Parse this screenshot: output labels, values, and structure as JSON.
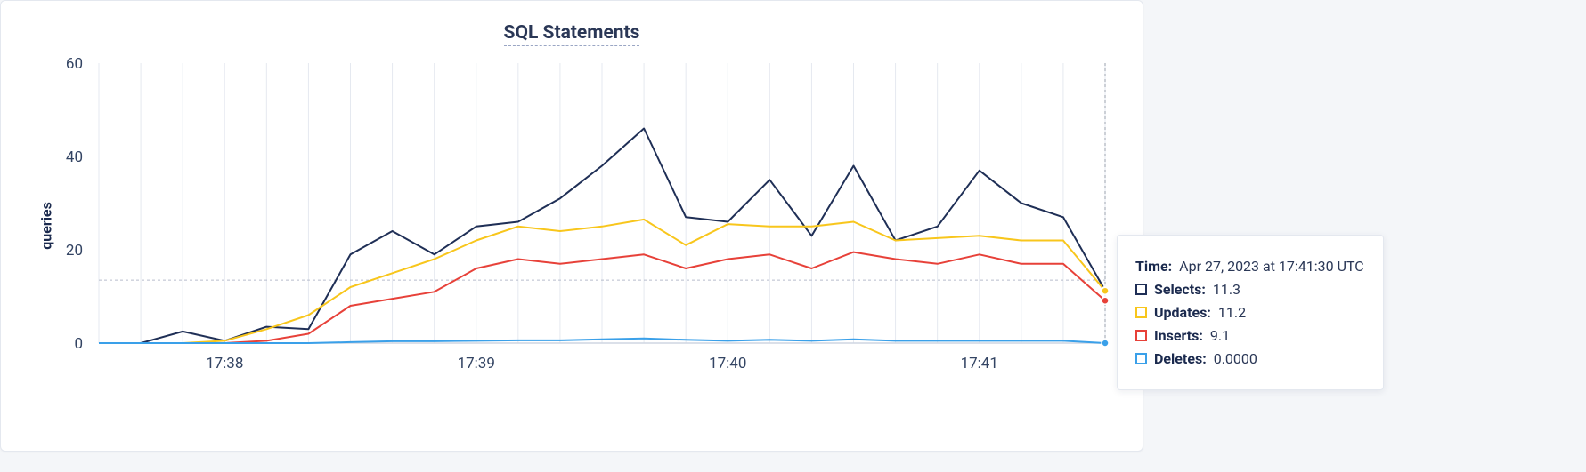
{
  "title": "SQL Statements",
  "ylabel": "queries",
  "tooltip": {
    "time_label": "Time:",
    "time_value": "Apr 27, 2023 at 17:41:30 UTC",
    "rows": [
      {
        "label": "Selects:",
        "value": "11.3"
      },
      {
        "label": "Updates:",
        "value": "11.2"
      },
      {
        "label": "Inserts:",
        "value": "9.1"
      },
      {
        "label": "Deletes:",
        "value": "0.0000"
      }
    ]
  },
  "colors": {
    "selects": "#1f2f56",
    "updates": "#f8c61c",
    "inserts": "#e74139",
    "deletes": "#3aa0e9"
  },
  "chart_data": {
    "type": "line",
    "xlabel": "",
    "ylabel": "queries",
    "title": "SQL Statements",
    "ylim": [
      0,
      60
    ],
    "yticks": [
      0,
      20,
      40,
      60
    ],
    "threshold": 13.5,
    "xticks_major": [
      "17:38",
      "17:39",
      "17:40",
      "17:41"
    ],
    "x": [
      "17:37:30",
      "17:37:40",
      "17:37:50",
      "17:38:00",
      "17:38:10",
      "17:38:20",
      "17:38:30",
      "17:38:40",
      "17:38:50",
      "17:39:00",
      "17:39:10",
      "17:39:20",
      "17:39:30",
      "17:39:40",
      "17:39:50",
      "17:40:00",
      "17:40:10",
      "17:40:20",
      "17:40:30",
      "17:40:40",
      "17:40:50",
      "17:41:00",
      "17:41:10",
      "17:41:20",
      "17:41:30"
    ],
    "cursor_index": 24,
    "series": [
      {
        "name": "Selects",
        "color": "#1f2f56",
        "values": [
          0,
          0,
          2.5,
          0.5,
          3.5,
          3,
          19,
          24,
          19,
          25,
          26,
          31,
          38,
          46,
          27,
          26,
          35,
          23,
          38,
          22,
          25,
          37,
          30,
          27,
          11.3
        ]
      },
      {
        "name": "Updates",
        "color": "#f8c61c",
        "values": [
          0,
          0,
          0,
          0.5,
          3,
          6,
          12,
          15,
          18,
          22,
          25,
          24,
          25,
          26.5,
          21,
          25.5,
          25,
          25,
          26,
          22,
          22.5,
          23,
          22,
          22,
          11.2
        ]
      },
      {
        "name": "Inserts",
        "color": "#e74139",
        "values": [
          0,
          0,
          0,
          0,
          0.5,
          2,
          8,
          9.5,
          11,
          16,
          18,
          17,
          18,
          19,
          16,
          18,
          19,
          16,
          19.5,
          18,
          17,
          19,
          17,
          17,
          9.1
        ]
      },
      {
        "name": "Deletes",
        "color": "#3aa0e9",
        "values": [
          0,
          0,
          0,
          0,
          0,
          0,
          0.2,
          0.4,
          0.4,
          0.5,
          0.6,
          0.6,
          0.8,
          1.0,
          0.7,
          0.5,
          0.7,
          0.5,
          0.8,
          0.5,
          0.5,
          0.5,
          0.5,
          0.5,
          0
        ]
      }
    ]
  }
}
